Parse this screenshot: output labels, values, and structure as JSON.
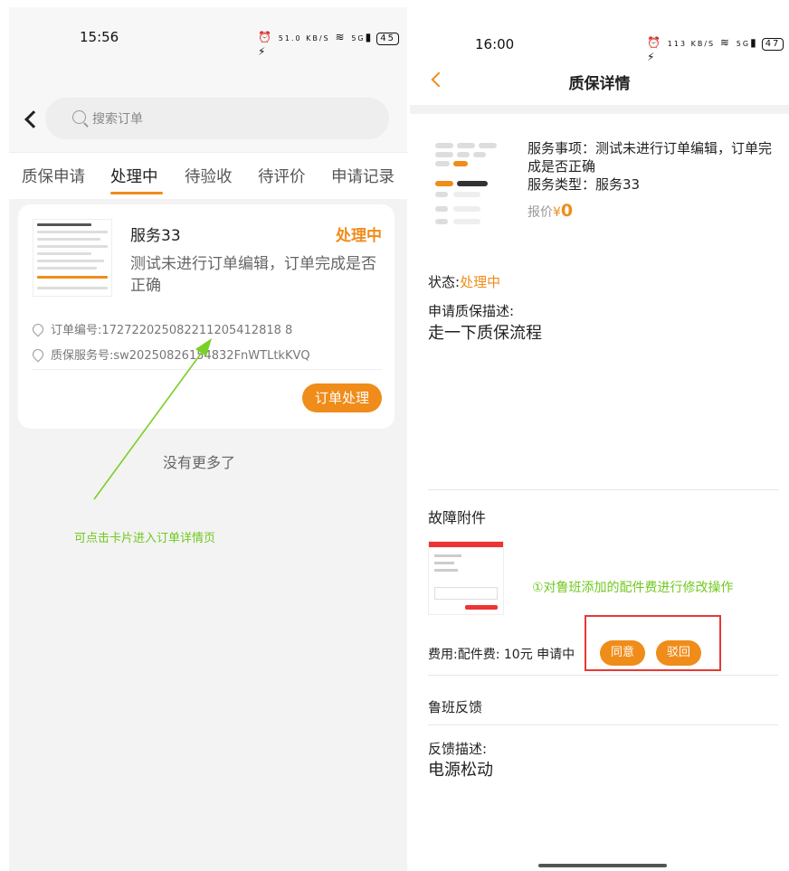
{
  "left_screen": {
    "status_bar": {
      "time": "15:56",
      "speed": "51.0 KB/S",
      "signal": "5G",
      "battery": "45"
    },
    "search": {
      "placeholder": "搜索订单"
    },
    "tabs": [
      {
        "label": "质保申请"
      },
      {
        "label": "处理中",
        "active": true
      },
      {
        "label": "待验收"
      },
      {
        "label": "待评价"
      },
      {
        "label": "申请记录"
      }
    ],
    "card": {
      "title": "服务33",
      "status": "处理中",
      "description": "测试未进行订单编辑，订单完成是否正确",
      "order_no": "订单编号:172722025082211205412818 8",
      "service_no": "质保服务号:sw20250826154832FnWTLtkKVQ",
      "action_label": "订单处理"
    },
    "no_more": "没有更多了",
    "annotation": "可点击卡片进入订单详情页"
  },
  "right_screen": {
    "status_bar": {
      "time": "16:00",
      "speed": "113 KB/S",
      "signal": "5G",
      "battery": "47"
    },
    "title": "质保详情",
    "service_item": "服务事项：测试未进行订单编辑，订单完成是否正确",
    "service_type": "服务类型：服务33",
    "price_label": "报价",
    "price_currency": "¥",
    "price_value": "0",
    "status_label": "状态:",
    "status_value": "处理中",
    "desc_label": "申请质保描述:",
    "desc_value": "走一下质保流程",
    "fault_title": "故障附件",
    "annotation": "①对鲁班添加的配件费进行修改操作",
    "fee_text": "费用:配件费: 10元 申请中",
    "agree_label": "同意",
    "reject_label": "驳回",
    "luban_feedback": "鲁班反馈",
    "feedback_label": "反馈描述:",
    "feedback_value": "电源松动"
  },
  "colors": {
    "accent": "#f08c1a",
    "annotation": "#6fc91e",
    "highlight_box": "#e53935"
  }
}
